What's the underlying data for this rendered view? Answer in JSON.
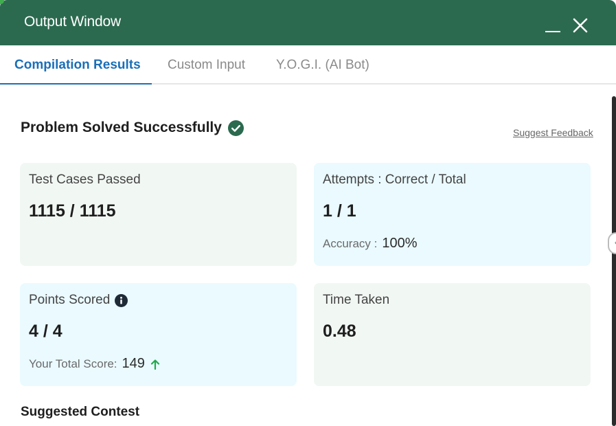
{
  "window": {
    "title": "Output Window"
  },
  "tabs": [
    {
      "label": "Compilation Results",
      "active": true
    },
    {
      "label": "Custom Input",
      "active": false
    },
    {
      "label": "Y.O.G.I. (AI Bot)",
      "active": false
    }
  ],
  "status": {
    "message": "Problem Solved Successfully",
    "icon": "check-circle-icon",
    "feedback_link": "Suggest Feedback"
  },
  "cards": {
    "test_cases": {
      "label": "Test Cases Passed",
      "value": "1115 / 1115"
    },
    "attempts": {
      "label": "Attempts : Correct / Total",
      "value": "1 / 1",
      "sub_label": "Accuracy :",
      "sub_value": "100%"
    },
    "points": {
      "label": "Points Scored",
      "value": "4 / 4",
      "sub_label": "Your Total Score:",
      "sub_value": "149"
    },
    "time": {
      "label": "Time Taken",
      "value": "0.48"
    }
  },
  "suggested": {
    "title": "Suggested Contest"
  },
  "colors": {
    "header_bg": "#2b6a4f",
    "active_tab": "#1a6fb8",
    "success_green": "#2b6a4f",
    "up_arrow_green": "#1fa94a",
    "card_grey": "#f1f7f3",
    "card_blue": "#eafaff"
  }
}
